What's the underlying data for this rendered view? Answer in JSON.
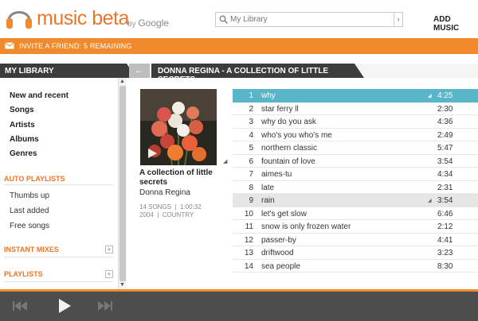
{
  "app": {
    "brand": "music beta",
    "by": "by",
    "google": "Google"
  },
  "search": {
    "placeholder": "My Library",
    "button": "›"
  },
  "header": {
    "add_music": "ADD MUSIC"
  },
  "invite": {
    "text": "INVITE A FRIEND: 5 REMAINING"
  },
  "sidebar": {
    "title": "MY LIBRARY",
    "items": [
      "New and recent",
      "Songs",
      "Artists",
      "Albums",
      "Genres"
    ],
    "auto_playlists": {
      "title": "AUTO PLAYLISTS",
      "items": [
        "Thumbs up",
        "Last added",
        "Free songs"
      ]
    },
    "instant_mixes": {
      "title": "INSTANT MIXES",
      "add": "+"
    },
    "playlists": {
      "title": "PLAYLISTS",
      "add": "+"
    }
  },
  "view": {
    "back": "←",
    "title": "DONNA REGINA - A COLLECTION OF LITTLE SECRETS"
  },
  "album": {
    "name": "A collection of little secrets",
    "artist": "Donna Regina",
    "songs": "14 SONGS",
    "length": "1:00:32",
    "year": "2004",
    "genre": "COUNTRY",
    "sep": "|"
  },
  "tracks": [
    {
      "num": "1",
      "title": "why",
      "duration": "4:25",
      "state": "selected"
    },
    {
      "num": "2",
      "title": "star ferry ll",
      "duration": "2:30",
      "state": ""
    },
    {
      "num": "3",
      "title": "why do you ask",
      "duration": "4:36",
      "state": ""
    },
    {
      "num": "4",
      "title": "who's you who's me",
      "duration": "2:49",
      "state": ""
    },
    {
      "num": "5",
      "title": "northern classic",
      "duration": "5:47",
      "state": ""
    },
    {
      "num": "6",
      "title": "fountain of love",
      "duration": "3:54",
      "state": ""
    },
    {
      "num": "7",
      "title": "aimes-tu",
      "duration": "4:34",
      "state": ""
    },
    {
      "num": "8",
      "title": "late",
      "duration": "2:31",
      "state": ""
    },
    {
      "num": "9",
      "title": "rain",
      "duration": "3:54",
      "state": "playing"
    },
    {
      "num": "10",
      "title": "let's get slow",
      "duration": "6:46",
      "state": ""
    },
    {
      "num": "11",
      "title": "snow is only frozen water",
      "duration": "2:12",
      "state": ""
    },
    {
      "num": "12",
      "title": "passer-by",
      "duration": "4:41",
      "state": ""
    },
    {
      "num": "13",
      "title": "driftwood",
      "duration": "3:23",
      "state": ""
    },
    {
      "num": "14",
      "title": "sea people",
      "duration": "8:30",
      "state": ""
    }
  ],
  "colors": {
    "accent": "#f08a2c",
    "selected": "#59b5c8",
    "dark": "#3c3c3c"
  },
  "icons": {
    "logo": "headphones-icon",
    "mail": "mail-icon",
    "search": "search-icon"
  }
}
